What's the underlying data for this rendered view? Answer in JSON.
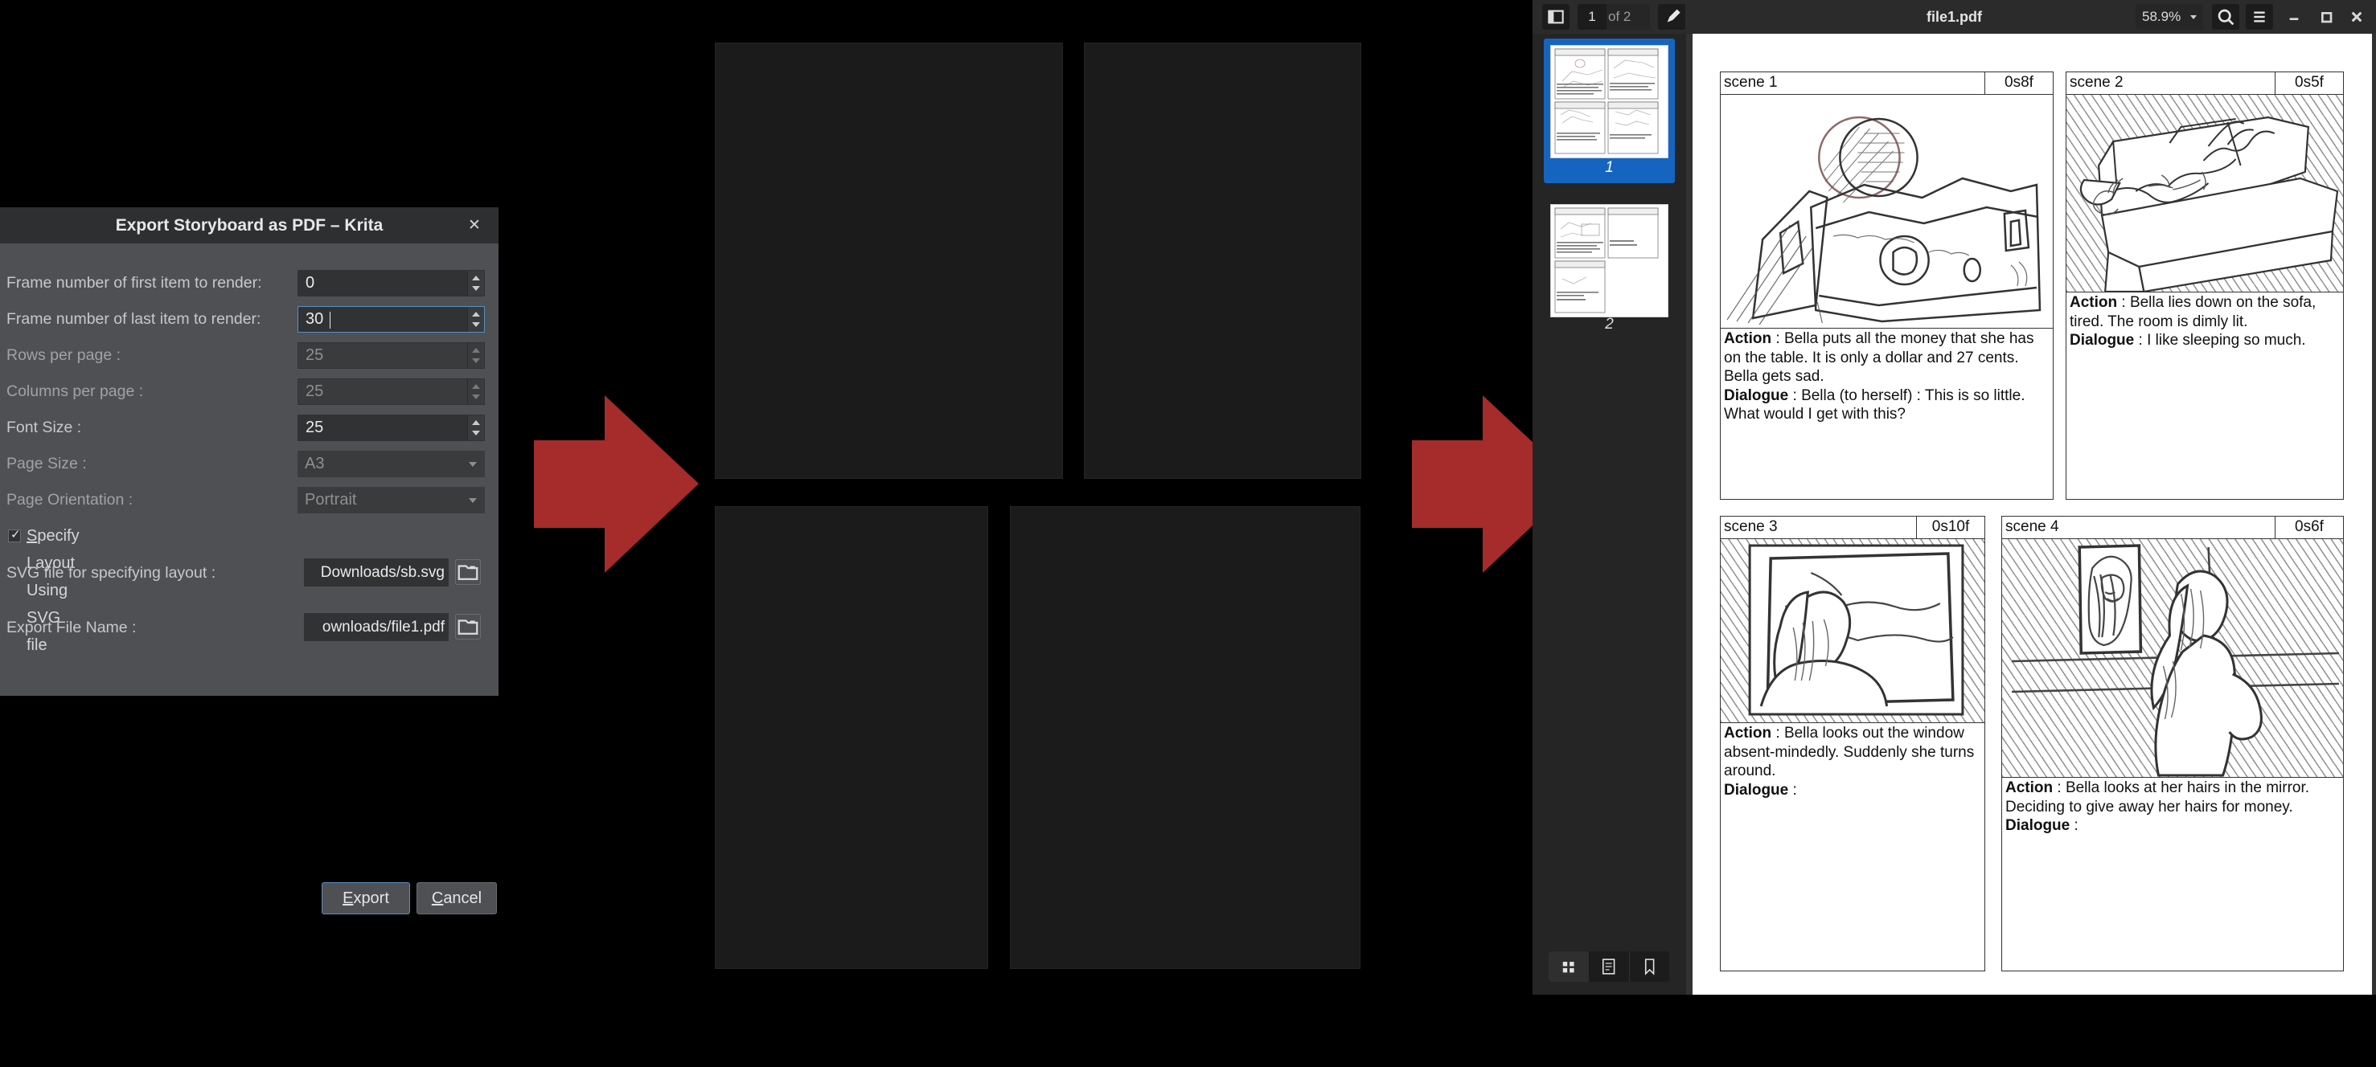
{
  "krita": {
    "dialog": {
      "title": "Export Storyboard as PDF – Krita",
      "close_label": "✕",
      "fields": [
        {
          "label": "Frame number of first item to render:",
          "value": "0",
          "disabled": false,
          "focused": false,
          "type": "spin"
        },
        {
          "label": "Frame number of last item to render:",
          "value": "30",
          "disabled": false,
          "focused": true,
          "type": "spin"
        },
        {
          "label": "Rows per page :",
          "value": "25",
          "disabled": true,
          "focused": false,
          "type": "spin"
        },
        {
          "label": "Columns per page :",
          "value": "25",
          "disabled": true,
          "focused": false,
          "type": "spin"
        },
        {
          "label": "Font Size :",
          "value": "25",
          "disabled": false,
          "focused": false,
          "type": "spin"
        },
        {
          "label": "Page Size :",
          "value": "A3",
          "disabled": true,
          "focused": false,
          "type": "combo"
        },
        {
          "label": "Page Orientation :",
          "value": "Portrait",
          "disabled": true,
          "focused": false,
          "type": "combo"
        }
      ],
      "checkbox": {
        "label_pre": "",
        "label_underlined": "S",
        "label_post": "pecify Layout Using SVG file",
        "checked": true,
        "tick": "✓"
      },
      "paths": [
        {
          "label": "SVG file for specifying layout :",
          "value": "Downloads/sb.svg",
          "browse_icon": "folder-icon"
        },
        {
          "label": "Export File Name :",
          "value": "ownloads/file1.pdf",
          "browse_icon": "folder-icon"
        }
      ],
      "buttons": {
        "export_pre": "",
        "export_underlined": "E",
        "export_post": "xport",
        "cancel_underlined": "C",
        "cancel_post": "ancel"
      }
    },
    "arrow_color": "#a62b2b",
    "arrows": [
      {
        "name": "arrow-to-pdf-1"
      },
      {
        "name": "arrow-to-pdf-2"
      }
    ]
  },
  "pdf_viewer": {
    "toolbar": {
      "sidebar_toggle_icon": "sidebar-panel-icon",
      "page_number": "1",
      "page_count": "of 2",
      "annotate_icon": "pen-icon",
      "title": "file1.pdf",
      "zoom_level": "58.9%",
      "zoom_chevron_icon": "chevron-down-icon",
      "search_icon": "search-icon",
      "menu_icon": "hamburger-menu-icon",
      "minimize_icon": "minimize-icon",
      "maximize_icon": "maximize-icon",
      "close_icon": "close-icon"
    },
    "sidebar": {
      "thumbnails": [
        {
          "number": "1",
          "selected": true
        },
        {
          "number": "2",
          "selected": false
        }
      ],
      "tools": [
        {
          "name": "thumbnails-view",
          "icon": "grid-icon",
          "active": true
        },
        {
          "name": "outline-view",
          "icon": "notes-icon",
          "active": false
        },
        {
          "name": "bookmarks-view",
          "icon": "bookmark-icon",
          "active": false
        }
      ]
    },
    "storyboard_panels": [
      {
        "scene": "scene 1",
        "time": "0s8f",
        "art": "money-on-table-sketch",
        "action_label": "Action",
        "action_text": " : Bella puts all the money that she has on the table. It is only a dollar and 27 cents. Bella gets sad.",
        "dialogue_label": "Dialogue",
        "dialogue_text": " : Bella (to herself) : This is so little. What would I get with this?"
      },
      {
        "scene": "scene 2",
        "time": "0s5f",
        "art": "girl-on-sofa-sketch",
        "action_label": "Action",
        "action_text": " : Bella lies down on the sofa, tired. The room is dimly lit.",
        "dialogue_label": "Dialogue",
        "dialogue_text": " : I like sleeping so much."
      },
      {
        "scene": "scene 3",
        "time": "0s10f",
        "art": "girl-at-window-sketch",
        "action_label": "Action",
        "action_text": " : Bella looks out the window absent-mindedly. Suddenly she turns around.",
        "dialogue_label": "Dialogue",
        "dialogue_text": " :"
      },
      {
        "scene": "scene 4",
        "time": "0s6f",
        "art": "girl-at-mirror-sketch",
        "action_label": "Action",
        "action_text": " : Bella looks at her hairs in the mirror. Deciding to give away her hairs for money.",
        "dialogue_label": "Dialogue",
        "dialogue_text": " :"
      }
    ]
  }
}
